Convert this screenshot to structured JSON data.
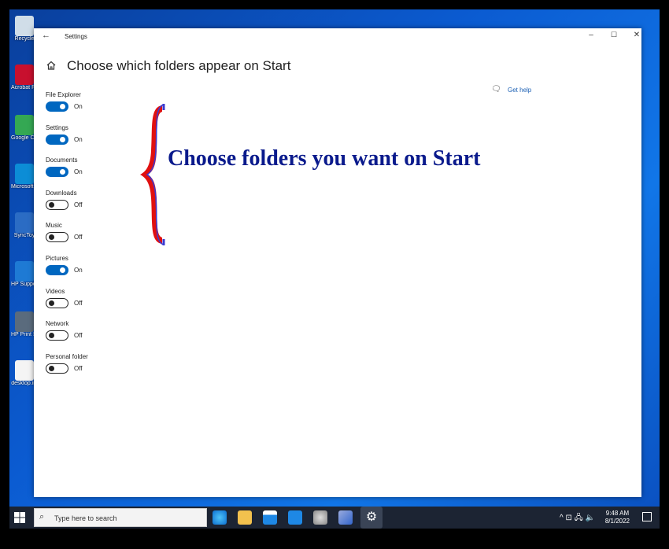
{
  "desktop": {
    "icons": [
      {
        "label": "Recycle",
        "color": "#d0dde8"
      },
      {
        "label": "Acrobat Reader",
        "color": "#c8102e"
      },
      {
        "label": "Google Chrome",
        "color": "#34a853"
      },
      {
        "label": "Microsoft Edge",
        "color": "#0c8dd6"
      },
      {
        "label": "SyncToy",
        "color": "#2b6cc4"
      },
      {
        "label": "HP Support Assist",
        "color": "#1e7ad4"
      },
      {
        "label": "HP Print Scan Doc",
        "color": "#5a6b7d"
      },
      {
        "label": "desktop.ini",
        "color": "#f4f4f4"
      }
    ]
  },
  "window": {
    "app_title": "Settings",
    "page_title": "Choose which folders appear on Start",
    "get_help": "Get help",
    "controls": {
      "minimize": "–",
      "maximize": "☐",
      "close": "✕"
    }
  },
  "settings": [
    {
      "name": "File Explorer",
      "state": "On",
      "on": true
    },
    {
      "name": "Settings",
      "state": "On",
      "on": true
    },
    {
      "name": "Documents",
      "state": "On",
      "on": true
    },
    {
      "name": "Downloads",
      "state": "Off",
      "on": false
    },
    {
      "name": "Music",
      "state": "Off",
      "on": false
    },
    {
      "name": "Pictures",
      "state": "On",
      "on": true
    },
    {
      "name": "Videos",
      "state": "Off",
      "on": false
    },
    {
      "name": "Network",
      "state": "Off",
      "on": false
    },
    {
      "name": "Personal folder",
      "state": "Off",
      "on": false
    }
  ],
  "annotation": {
    "text": "Choose folders you want on Start",
    "color": "#0a1a8c",
    "brace_color": "#e01010"
  },
  "taskbar": {
    "search_placeholder": "Type here to search",
    "time": "9:48 AM",
    "date": "8/1/2022",
    "tray_icons": "^ ⊡ 🖧 🔈"
  },
  "colors": {
    "accent": "#0067c0",
    "desktop": "#0b5bd1",
    "taskbar": "#1c2433"
  }
}
